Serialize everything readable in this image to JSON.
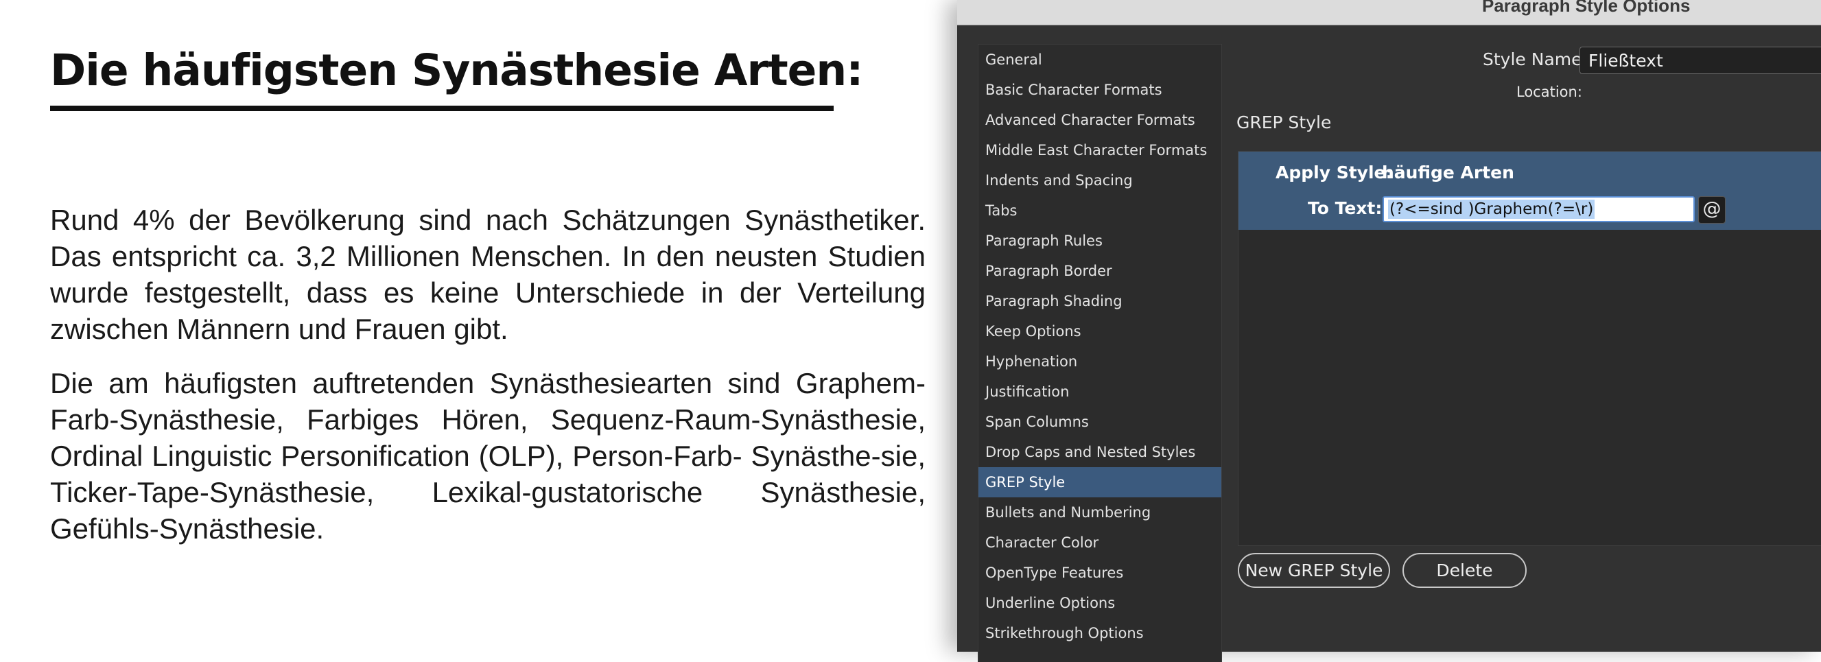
{
  "document": {
    "title": "Die häufigsten Synästhesie Arten:",
    "paragraphs": [
      "Rund 4% der Bevölkerung sind nach Schätzungen Synästhetiker. Das entspricht ca. 3,2 Millionen Menschen. In den neusten Studien wurde festgestellt, dass es keine Unterschiede in der Verteilung zwischen Männern und Frauen gibt.",
      "Die am häufigsten auftretenden Synästhesiearten sind Graphem-Farb-Synästhesie, Farbiges Hören, Sequenz-Raum-Synästhesie, Ordinal Linguistic Personification (OLP), Person-Farb- Synästhe-sie, Ticker-Tape-Synästhesie, Lexikal-gustatorische Synästhesie, Gefühls-Synästhesie."
    ]
  },
  "dialog": {
    "title": "Paragraph Style Options",
    "style_name_label": "Style Name:",
    "style_name_value": "Fließtext",
    "location_label": "Location:",
    "section_title": "GREP Style",
    "nav_items": [
      "General",
      "Basic Character Formats",
      "Advanced Character Formats",
      "Middle East Character Formats",
      "Indents and Spacing",
      "Tabs",
      "Paragraph Rules",
      "Paragraph Border",
      "Paragraph Shading",
      "Keep Options",
      "Hyphenation",
      "Justification",
      "Span Columns",
      "Drop Caps and Nested Styles",
      "GREP Style",
      "Bullets and Numbering",
      "Character Color",
      "OpenType Features",
      "Underline Options",
      "Strikethrough Options"
    ],
    "active_nav_item": "GREP Style",
    "grep_rule": {
      "apply_label": "Apply Style:",
      "apply_value": "häufige Arten",
      "to_text_label": "To Text:",
      "to_text_value": "(?<=sind )Graphem(?=\\r)",
      "special_chars_button": "@"
    },
    "buttons": {
      "new": "New GREP Style",
      "delete": "Delete"
    }
  },
  "colors": {
    "dialog_bg": "#323232",
    "active_nav": "#3b5a7e",
    "grep_rule_bg": "#3d5a7a",
    "selection": "#b5d3f5"
  }
}
